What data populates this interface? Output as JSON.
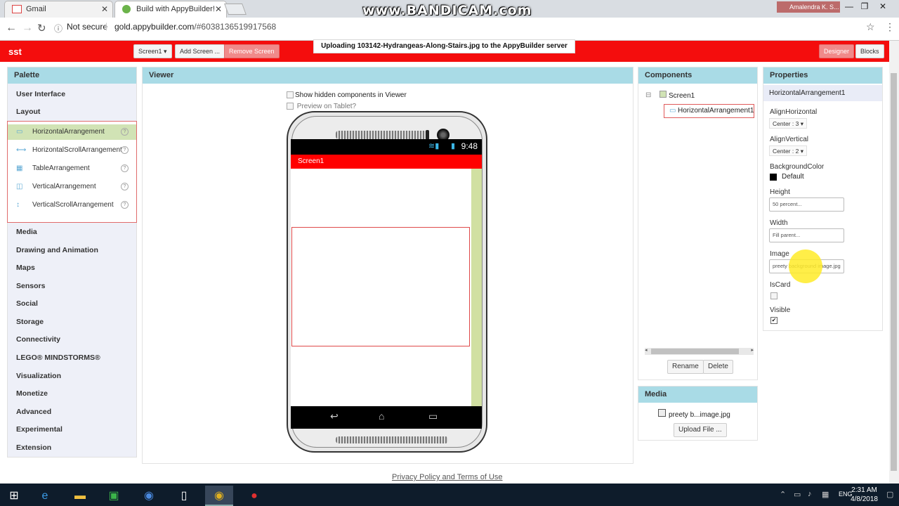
{
  "browser": {
    "tabs": [
      {
        "title": "Gmail"
      },
      {
        "title": "Build with AppyBuilder!"
      }
    ],
    "watermark": "www.BANDICAM.com",
    "user": "Amalendra K. S...",
    "security": "Not secure",
    "url_host": "gold.appybuilder.com",
    "url_path": "/#6038136519917568"
  },
  "app": {
    "name": "sst",
    "screen_select": "Screen1",
    "add_screen": "Add Screen ...",
    "remove_screen": "Remove Screen",
    "upload_message": "Uploading 103142-Hydrangeas-Along-Stairs.jpg to the AppyBuilder server",
    "designer": "Designer",
    "blocks": "Blocks"
  },
  "palette": {
    "title": "Palette",
    "categories_top": [
      "User Interface",
      "Layout"
    ],
    "layout_items": [
      {
        "label": "HorizontalArrangement",
        "icon": "horizontal-arrangement-icon"
      },
      {
        "label": "HorizontalScrollArrangement",
        "icon": "horizontal-scroll-icon"
      },
      {
        "label": "TableArrangement",
        "icon": "table-icon"
      },
      {
        "label": "VerticalArrangement",
        "icon": "vertical-arrangement-icon"
      },
      {
        "label": "VerticalScrollArrangement",
        "icon": "vertical-scroll-icon"
      }
    ],
    "categories_bottom": [
      "Media",
      "Drawing and Animation",
      "Maps",
      "Sensors",
      "Social",
      "Storage",
      "Connectivity",
      "LEGO® MINDSTORMS®",
      "Visualization",
      "Monetize",
      "Advanced",
      "Experimental",
      "Extension"
    ]
  },
  "viewer": {
    "title": "Viewer",
    "show_hidden": "Show hidden components in Viewer",
    "preview_tablet": "Preview on Tablet?",
    "status_time": "9:48",
    "screen_title": "Screen1"
  },
  "components": {
    "title": "Components",
    "root": "Screen1",
    "child": "HorizontalArrangement1",
    "rename": "Rename",
    "delete": "Delete"
  },
  "media": {
    "title": "Media",
    "file": "preety b...image.jpg",
    "upload": "Upload File ..."
  },
  "properties": {
    "title": "Properties",
    "component": "HorizontalArrangement1",
    "align_horizontal_label": "AlignHorizontal",
    "align_horizontal_value": "Center : 3",
    "align_vertical_label": "AlignVertical",
    "align_vertical_value": "Center : 2",
    "background_color_label": "BackgroundColor",
    "background_color_value": "Default",
    "height_label": "Height",
    "height_value": "50 percent...",
    "width_label": "Width",
    "width_value": "Fill parent...",
    "image_label": "Image",
    "image_value": "preety background image.jpg",
    "iscard_label": "IsCard",
    "visible_label": "Visible"
  },
  "footer": {
    "privacy": "Privacy Policy and Terms of Use"
  },
  "taskbar": {
    "time": "2:31 AM",
    "date": "4/8/2018",
    "lang": "ENG"
  },
  "colors": {
    "accent_red": "#f40d0d",
    "panel_header": "#a9dbe6",
    "selected_item": "#d1e3b5"
  }
}
